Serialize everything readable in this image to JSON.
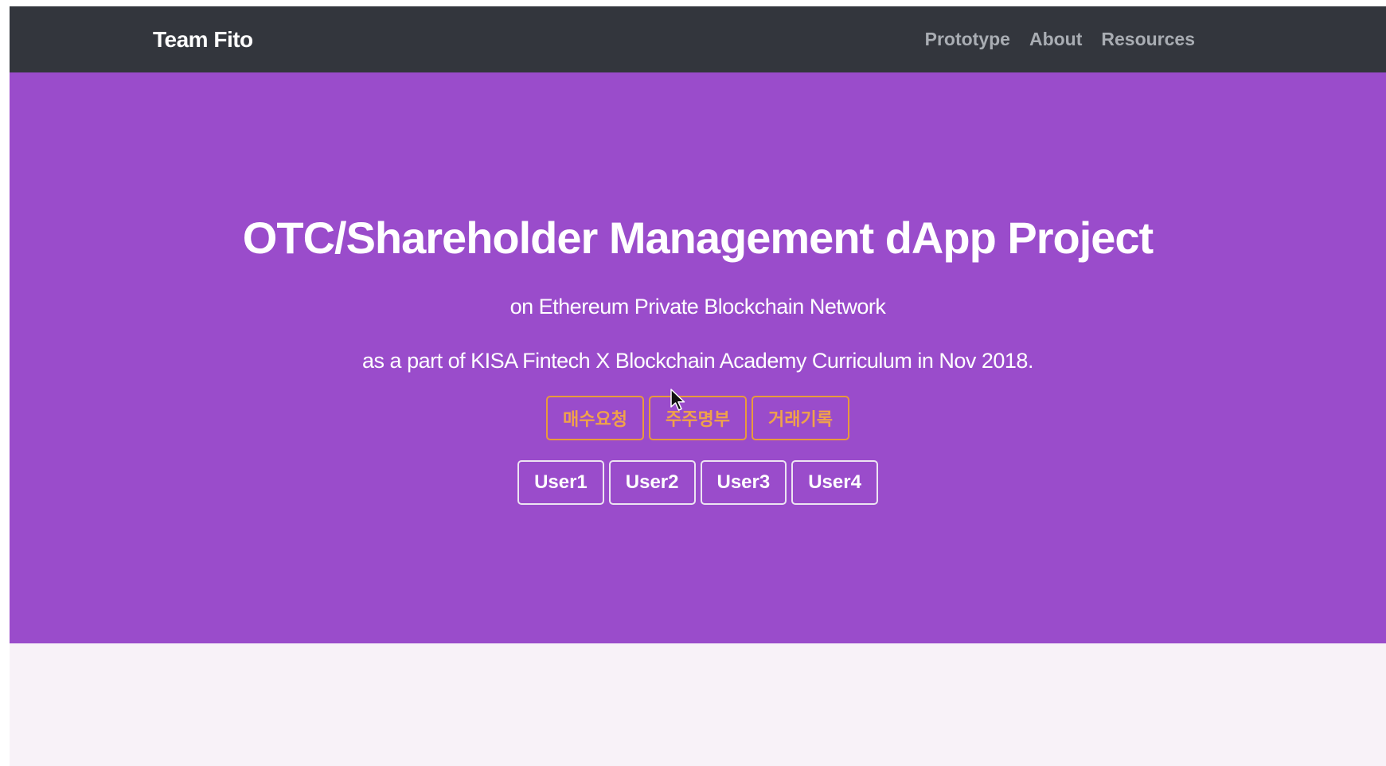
{
  "navbar": {
    "brand": "Team Fito",
    "links": [
      "Prototype",
      "About",
      "Resources"
    ]
  },
  "hero": {
    "title": "OTC/Shareholder Management dApp Project",
    "subtitle_1": "on Ethereum Private Blockchain Network",
    "subtitle_2": "as a part of KISA Fintech X Blockchain Academy Curriculum in Nov 2018.",
    "action_buttons": [
      "매수요청",
      "주주명부",
      "거래기록"
    ],
    "user_buttons": [
      "User1",
      "User2",
      "User3",
      "User4"
    ]
  },
  "colors": {
    "navbar_bg": "#33363d",
    "hero_bg": "#9a4ccb",
    "warning_accent": "#e99a3b",
    "page_bg": "#f8f2f8"
  },
  "icons": {
    "cursor": "mouse-pointer-icon"
  }
}
